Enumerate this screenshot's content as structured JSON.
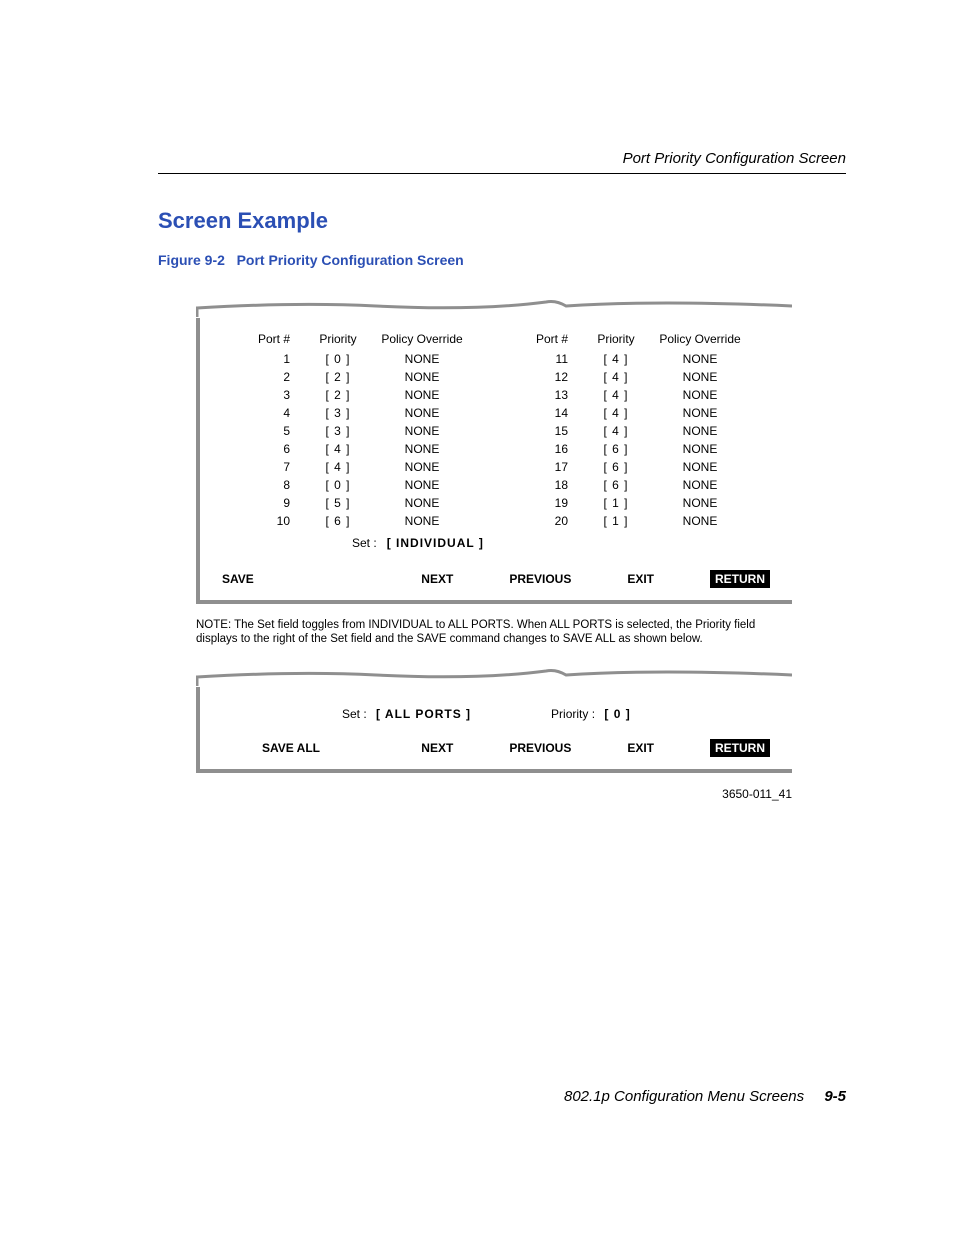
{
  "running_header": "Port Priority Configuration Screen",
  "section_title": "Screen Example",
  "figure_caption_label": "Figure 9-2",
  "figure_caption_title": "Port Priority Configuration Screen",
  "headers": {
    "port": "Port #",
    "priority": "Priority",
    "override": "Policy Override"
  },
  "left_rows": [
    {
      "port": "1",
      "priority": "[ 0 ]",
      "override": "NONE"
    },
    {
      "port": "2",
      "priority": "[ 2 ]",
      "override": "NONE"
    },
    {
      "port": "3",
      "priority": "[ 2 ]",
      "override": "NONE"
    },
    {
      "port": "4",
      "priority": "[ 3 ]",
      "override": "NONE"
    },
    {
      "port": "5",
      "priority": "[ 3 ]",
      "override": "NONE"
    },
    {
      "port": "6",
      "priority": "[ 4 ]",
      "override": "NONE"
    },
    {
      "port": "7",
      "priority": "[ 4 ]",
      "override": "NONE"
    },
    {
      "port": "8",
      "priority": "[ 0 ]",
      "override": "NONE"
    },
    {
      "port": "9",
      "priority": "[ 5 ]",
      "override": "NONE"
    },
    {
      "port": "10",
      "priority": "[ 6 ]",
      "override": "NONE"
    }
  ],
  "right_rows": [
    {
      "port": "11",
      "priority": "[ 4 ]",
      "override": "NONE"
    },
    {
      "port": "12",
      "priority": "[ 4 ]",
      "override": "NONE"
    },
    {
      "port": "13",
      "priority": "[ 4 ]",
      "override": "NONE"
    },
    {
      "port": "14",
      "priority": "[ 4 ]",
      "override": "NONE"
    },
    {
      "port": "15",
      "priority": "[ 4 ]",
      "override": "NONE"
    },
    {
      "port": "16",
      "priority": "[ 6 ]",
      "override": "NONE"
    },
    {
      "port": "17",
      "priority": "[ 6 ]",
      "override": "NONE"
    },
    {
      "port": "18",
      "priority": "[ 6 ]",
      "override": "NONE"
    },
    {
      "port": "19",
      "priority": "[ 1 ]",
      "override": "NONE"
    },
    {
      "port": "20",
      "priority": "[ 1 ]",
      "override": "NONE"
    }
  ],
  "set_label": "Set :",
  "set_value_individual": "[ INDIVIDUAL ]",
  "commands1": {
    "save": "SAVE",
    "next": "NEXT",
    "previous": "PREVIOUS",
    "exit": "EXIT",
    "ret": "RETURN"
  },
  "note_text": "NOTE: The Set field toggles from INDIVIDUAL to ALL PORTS. When ALL PORTS is selected, the Priority field displays to the right of  the Set field and the SAVE command changes to SAVE ALL as shown below.",
  "set_value_all": "[ ALL PORTS ]",
  "priority_label": "Priority :",
  "priority_value": "[ 0  ]",
  "commands2": {
    "save": "SAVE ALL",
    "next": "NEXT",
    "previous": "PREVIOUS",
    "exit": "EXIT",
    "ret": "RETURN"
  },
  "artifact_id": "3650-011_41",
  "footer_book": "802.1p Configuration Menu Screens",
  "footer_page": "9-5"
}
